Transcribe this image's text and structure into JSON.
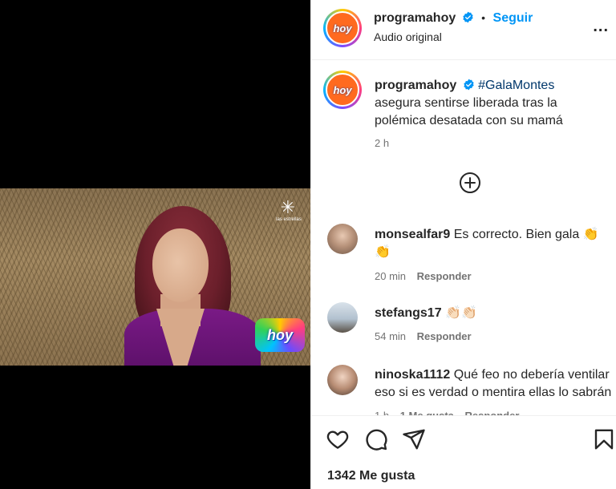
{
  "video": {
    "watermark_text": "las estrellas",
    "bug_text": "hoy"
  },
  "post": {
    "username": "programahoy",
    "follow_label": "Seguir",
    "audio_label": "Audio original",
    "more_label": "...",
    "avatar_text": "hoy"
  },
  "caption": {
    "username": "programahoy",
    "hashtag": "#GalaMontes",
    "text_line1": "asegura sentirse liberada tras la",
    "text_line2": "polémica desatada con su mamá",
    "time": "2 h"
  },
  "comments": [
    {
      "username": "monsealfar9",
      "text": "Es correcto. Bien gala 👏",
      "text2": "👏",
      "time": "20 min",
      "reply": "Responder"
    },
    {
      "username": "stefangs17",
      "text": "👏🏻👏🏻",
      "time": "54 min",
      "reply": "Responder"
    },
    {
      "username": "ninoska1112",
      "text": "Qué feo no debería ventilar",
      "text2": "eso si es verdad o mentira ellas lo sabrán",
      "time": "1 h",
      "likes": "1 Me gusta",
      "reply": "Responder"
    }
  ],
  "footer": {
    "likes": "1342 Me gusta"
  },
  "colors": {
    "accent": "#0095f6",
    "hashtag": "#00376b",
    "muted": "#737373"
  }
}
